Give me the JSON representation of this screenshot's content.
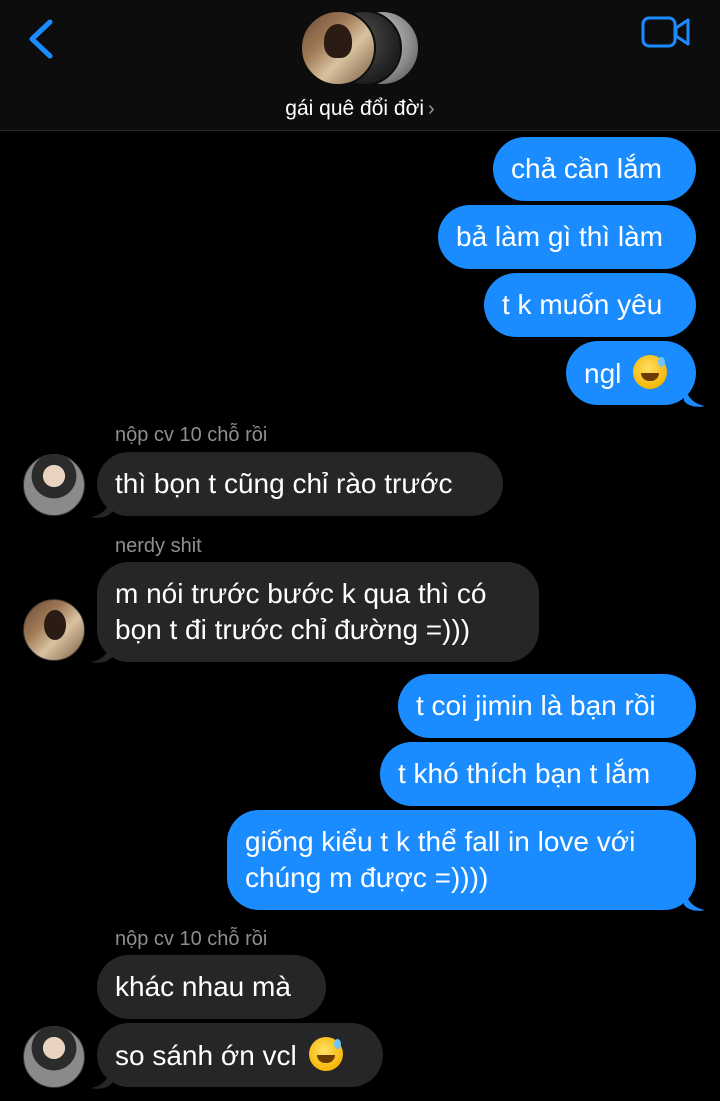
{
  "header": {
    "group_name": "gái quê đổi đời",
    "chevron": "›",
    "back_icon": "chevron-left-icon",
    "video_icon": "video-camera-icon"
  },
  "colors": {
    "sent_bubble": "#1a8cff",
    "received_bubble": "#262628",
    "accent": "#1a8cff"
  },
  "messages": [
    {
      "direction": "sent",
      "text": "chả cần lắm"
    },
    {
      "direction": "sent",
      "text": "bả làm gì thì làm"
    },
    {
      "direction": "sent",
      "text": "t k muốn yêu"
    },
    {
      "direction": "sent",
      "text": "ngl",
      "emoji": "sweat-smile-emoji"
    },
    {
      "direction": "received",
      "sender": "nộp cv 10 chỗ rồi",
      "text": "thì bọn t cũng chỉ rào trước"
    },
    {
      "direction": "received",
      "sender": "nerdy shit",
      "text_line1": "m nói trước bước k qua thì có",
      "text_line2": "bọn t đi trước chỉ đường =)))"
    },
    {
      "direction": "sent",
      "text": "t coi jimin là bạn rồi"
    },
    {
      "direction": "sent",
      "text": "t khó thích bạn t lắm"
    },
    {
      "direction": "sent",
      "text_line1": "giống kiểu t k thể fall in love với",
      "text_line2": "chúng m được =))))"
    },
    {
      "direction": "received",
      "sender": "nộp cv 10 chỗ rồi",
      "text": "khác nhau mà"
    },
    {
      "direction": "received",
      "text": "so sánh ớn vcl",
      "emoji": "sweat-smile-emoji"
    }
  ]
}
